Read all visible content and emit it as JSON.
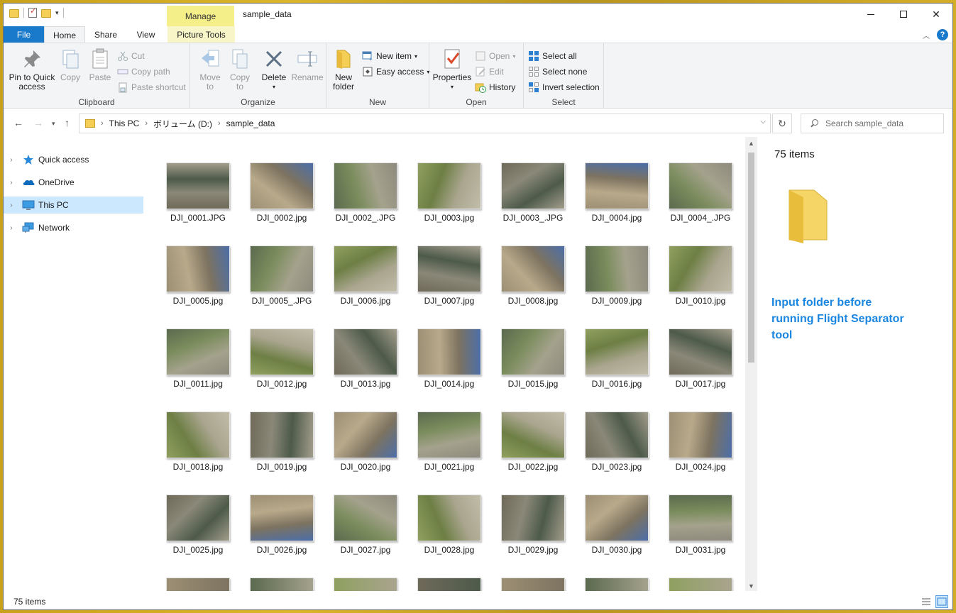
{
  "window": {
    "title": "sample_data",
    "contextual_tab": "Manage"
  },
  "ribbon_tabs": [
    "File",
    "Home",
    "Share",
    "View",
    "Picture Tools"
  ],
  "ribbon": {
    "clipboard": {
      "label": "Clipboard",
      "pin": "Pin to Quick",
      "pin2": "access",
      "copy": "Copy",
      "paste": "Paste",
      "cut": "Cut",
      "copy_path": "Copy path",
      "paste_shortcut": "Paste shortcut"
    },
    "organize": {
      "label": "Organize",
      "move": "Move",
      "move2": "to",
      "copy": "Copy",
      "copy2": "to",
      "delete": "Delete",
      "rename": "Rename"
    },
    "new": {
      "label": "New",
      "new_folder": "New",
      "new_folder2": "folder",
      "new_item": "New item",
      "easy_access": "Easy access"
    },
    "open": {
      "label": "Open",
      "properties": "Properties",
      "open": "Open",
      "edit": "Edit",
      "history": "History"
    },
    "select": {
      "label": "Select",
      "select_all": "Select all",
      "select_none": "Select none",
      "invert": "Invert selection"
    }
  },
  "address": {
    "crumbs": [
      "This PC",
      "ボリューム (D:)",
      "sample_data"
    ],
    "search_placeholder": "Search sample_data"
  },
  "nav_pane": [
    {
      "label": "Quick access",
      "icon": "star-icon"
    },
    {
      "label": "OneDrive",
      "icon": "cloud-icon"
    },
    {
      "label": "This PC",
      "icon": "monitor-icon",
      "selected": true
    },
    {
      "label": "Network",
      "icon": "network-icon"
    }
  ],
  "files": [
    "DJI_0001.JPG",
    "DJI_0002.jpg",
    "DJI_0002_.JPG",
    "DJI_0003.jpg",
    "DJI_0003_.JPG",
    "DJI_0004.jpg",
    "DJI_0004_.JPG",
    "DJI_0005.jpg",
    "DJI_0005_.JPG",
    "DJI_0006.jpg",
    "DJI_0007.jpg",
    "DJI_0008.jpg",
    "DJI_0009.jpg",
    "DJI_0010.jpg",
    "DJI_0011.jpg",
    "DJI_0012.jpg",
    "DJI_0013.jpg",
    "DJI_0014.jpg",
    "DJI_0015.jpg",
    "DJI_0016.jpg",
    "DJI_0017.jpg",
    "DJI_0018.jpg",
    "DJI_0019.jpg",
    "DJI_0020.jpg",
    "DJI_0021.jpg",
    "DJI_0022.jpg",
    "DJI_0023.jpg",
    "DJI_0024.jpg",
    "DJI_0025.jpg",
    "DJI_0026.jpg",
    "DJI_0027.jpg",
    "DJI_0028.jpg",
    "DJI_0029.jpg",
    "DJI_0030.jpg",
    "DJI_0031.jpg"
  ],
  "preview": {
    "count": "75 items",
    "annotation": "Input folder before running Flight Separator tool"
  },
  "status": {
    "count": "75 items"
  },
  "colors": {
    "accent": "#1979ca",
    "annotation": "#1a86e0",
    "selected_bg": "#cce8ff",
    "manage_tab": "#f5ef8a"
  }
}
